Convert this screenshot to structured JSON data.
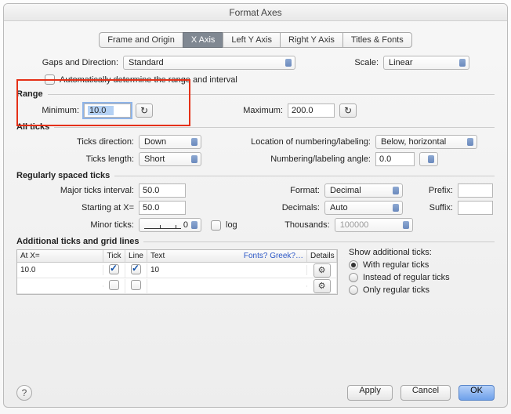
{
  "title": "Format Axes",
  "tabs": [
    "Frame and Origin",
    "X Axis",
    "Left Y Axis",
    "Right Y Axis",
    "Titles & Fonts"
  ],
  "activeTab": 1,
  "gapsDirection": {
    "label": "Gaps and Direction:",
    "value": "Standard"
  },
  "scale": {
    "label": "Scale:",
    "value": "Linear"
  },
  "autoRange": {
    "label": "Automatically determine the range and interval",
    "checked": false
  },
  "sections": {
    "range": "Range",
    "allTicks": "All ticks",
    "regTicks": "Regularly spaced ticks",
    "addTicks": "Additional ticks and grid lines"
  },
  "range": {
    "minLabel": "Minimum:",
    "min": "10.0",
    "maxLabel": "Maximum:",
    "max": "200.0"
  },
  "allTicks": {
    "dirLabel": "Ticks direction:",
    "dir": "Down",
    "lenLabel": "Ticks length:",
    "len": "Short",
    "locLabel": "Location of numbering/labeling:",
    "loc": "Below, horizontal",
    "angleLabel": "Numbering/labeling angle:",
    "angle": "0.0"
  },
  "regTicks": {
    "intervalLabel": "Major ticks interval:",
    "interval": "50.0",
    "startLabel": "Starting at X=",
    "start": "50.0",
    "minorLabel": "Minor ticks:",
    "minorVal": "0",
    "logLabel": "log",
    "formatLabel": "Format:",
    "format": "Decimal",
    "decimalsLabel": "Decimals:",
    "decimals": "Auto",
    "thousandsLabel": "Thousands:",
    "thousands": "100000",
    "prefixLabel": "Prefix:",
    "prefix": "",
    "suffixLabel": "Suffix:",
    "suffix": ""
  },
  "addTable": {
    "headers": {
      "atx": "At X=",
      "tick": "Tick",
      "line": "Line",
      "text": "Text",
      "details": "Details"
    },
    "fontsLink": "Fonts? Greek?…",
    "rows": [
      {
        "atx": "10.0",
        "tick": true,
        "line": true,
        "text": "10"
      },
      {
        "atx": "",
        "tick": false,
        "line": false,
        "text": ""
      }
    ]
  },
  "showAdditional": {
    "label": "Show additional ticks:",
    "options": [
      "With regular ticks",
      "Instead of regular ticks",
      "Only regular ticks"
    ],
    "selected": 0
  },
  "buttons": {
    "apply": "Apply",
    "cancel": "Cancel",
    "ok": "OK",
    "help": "?"
  }
}
